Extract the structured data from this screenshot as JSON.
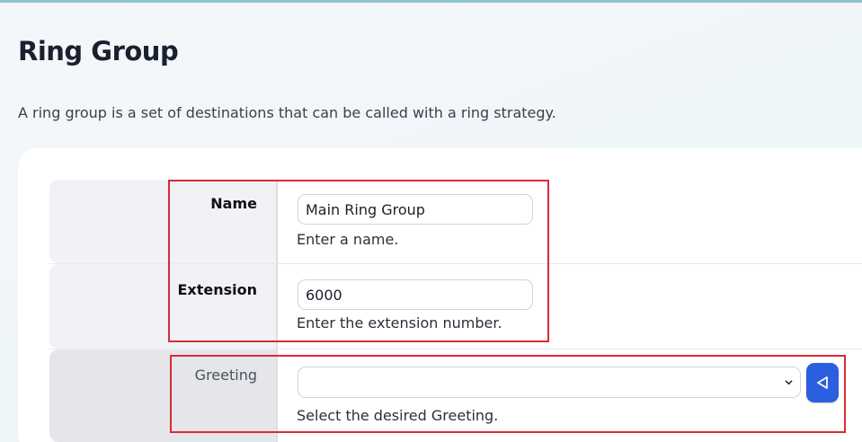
{
  "page": {
    "title": "Ring Group",
    "description": "A ring group is a set of destinations that can be called with a ring strategy."
  },
  "form": {
    "name": {
      "label": "Name",
      "value": "Main Ring Group",
      "help": "Enter a name."
    },
    "extension": {
      "label": "Extension",
      "value": "6000",
      "help": "Enter the extension number."
    },
    "greeting": {
      "label": "Greeting",
      "selected": "",
      "help": "Select the desired Greeting.",
      "play_icon": "play-triangle-icon"
    }
  },
  "colors": {
    "accent": "#2a5fe0",
    "highlight": "#d92b35"
  }
}
